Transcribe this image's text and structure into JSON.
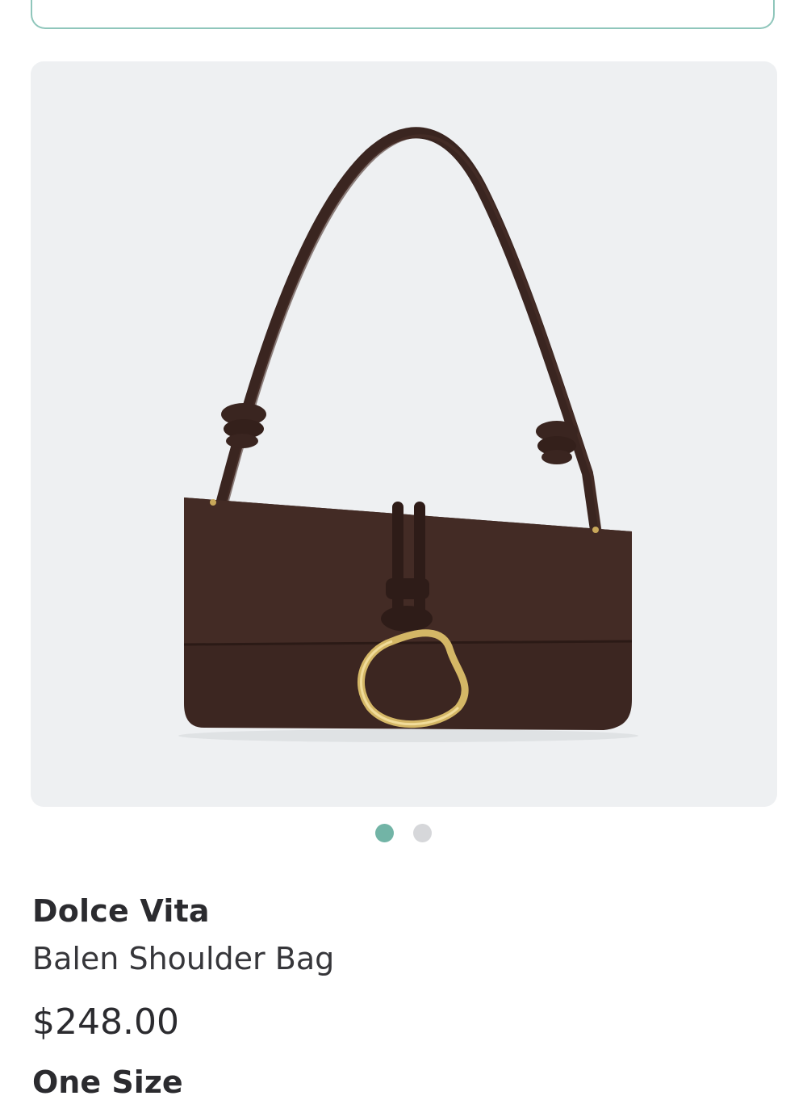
{
  "product": {
    "brand": "Dolce Vita",
    "name": "Balen Shoulder Bag",
    "price": "$248.00",
    "size_label": "One Size"
  },
  "gallery": {
    "image_label": "dark brown suede shoulder bag with knotted strap and gold ring",
    "page_count": 2,
    "active_index": 0
  },
  "colors": {
    "accent": "#72b4a6",
    "dot_inactive": "#d6d7da",
    "image_bg": "#eef0f2",
    "bag": "#3a2520"
  }
}
